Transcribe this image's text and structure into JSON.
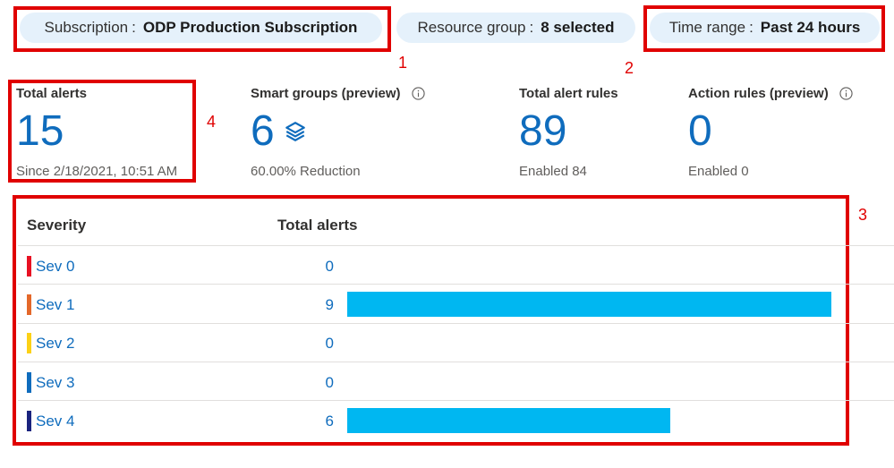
{
  "filters": {
    "subscription": {
      "label": "Subscription",
      "separator": ":",
      "value": "ODP Production Subscription"
    },
    "resource_group": {
      "label": "Resource group",
      "separator": ":",
      "value": "8 selected"
    },
    "time_range": {
      "label": "Time range",
      "separator": ":",
      "value": "Past 24 hours"
    }
  },
  "callouts": [
    "1",
    "2",
    "3",
    "4"
  ],
  "summary": {
    "total_alerts": {
      "title": "Total alerts",
      "value": "15",
      "sub": "Since 2/18/2021, 10:51 AM"
    },
    "smart_groups": {
      "title": "Smart groups (preview)",
      "value": "6",
      "sub": "60.00% Reduction",
      "icon": "layers-icon"
    },
    "alert_rules": {
      "title": "Total alert rules",
      "value": "89",
      "sub": "Enabled 84"
    },
    "action_rules": {
      "title": "Action rules (preview)",
      "value": "0",
      "sub": "Enabled 0"
    }
  },
  "severity_table": {
    "col_severity": "Severity",
    "col_total": "Total alerts",
    "max_value": 9,
    "rows": [
      {
        "label": "Sev 0",
        "count": "0",
        "value": 0,
        "color": "#e81123"
      },
      {
        "label": "Sev 1",
        "count": "9",
        "value": 9,
        "color": "#e4682a"
      },
      {
        "label": "Sev 2",
        "count": "0",
        "value": 0,
        "color": "#fcd116"
      },
      {
        "label": "Sev 3",
        "count": "0",
        "value": 0,
        "color": "#0f6cbd"
      },
      {
        "label": "Sev 4",
        "count": "6",
        "value": 6,
        "color": "#1a237e"
      }
    ],
    "bar_color": "#00b7f1"
  }
}
